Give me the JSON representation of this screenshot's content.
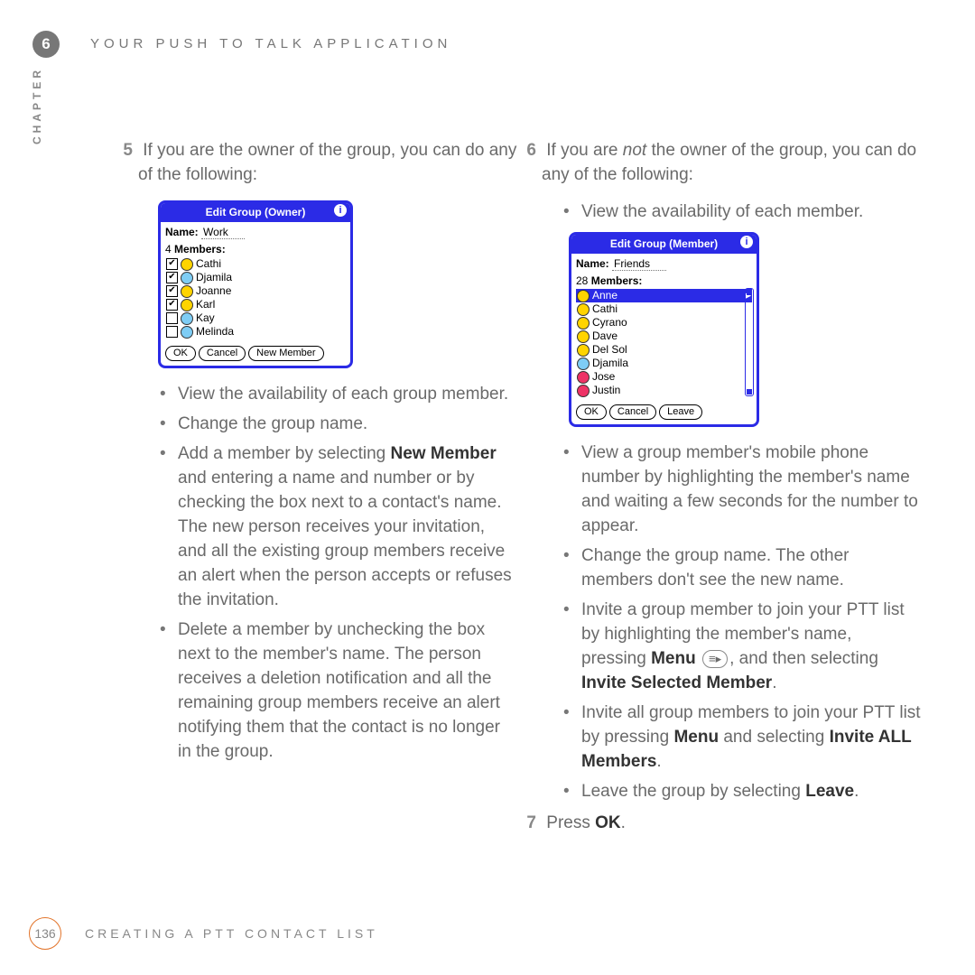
{
  "header": {
    "chapter_number": "6",
    "chapter_title": "YOUR PUSH TO TALK APPLICATION",
    "side_label": "CHAPTER"
  },
  "footer": {
    "page_number": "136",
    "section_title": "CREATING A PTT CONTACT LIST"
  },
  "left": {
    "step_num": "5",
    "intro": "If you are the owner of the group, you can do any of the following:",
    "bullets": {
      "b1": "View the availability of each group member.",
      "b2": "Change the group name.",
      "b3_pre": "Add a member by selecting ",
      "b3_bold": "New Member",
      "b3_post": " and entering a name and number or by checking the box next to a contact's name. The new person receives your invitation, and all the existing group members receive an alert when the person accepts or refuses the invitation.",
      "b4": "Delete a member by unchecking the box next to the member's name. The person receives a deletion notification and all the remaining group members receive an alert notifying them that the contact is no longer in the group."
    }
  },
  "right": {
    "step_num": "6",
    "intro_pre": "If you are ",
    "intro_em": "not",
    "intro_post": " the owner of the group, you can do any of the following:",
    "bullets": {
      "b1": "View the availability of each member.",
      "b2": "View a group member's mobile phone number by highlighting the member's name and waiting a few seconds for the number to appear.",
      "b3": "Change the group name. The other members don't see the new name.",
      "b4_pre": "Invite a group member to join your PTT list by highlighting the member's name, pressing ",
      "b4_menu": "Menu",
      "b4_mid": ", and then selecting ",
      "b4_bold": "Invite Selected Member",
      "b4_end": ".",
      "b5_pre": "Invite all group members to join your PTT list by pressing ",
      "b5_menu": "Menu",
      "b5_mid": " and selecting ",
      "b5_bold": "Invite ALL Members",
      "b5_end": ".",
      "b6_pre": "Leave the group by selecting ",
      "b6_bold": "Leave",
      "b6_end": "."
    },
    "step7_num": "7",
    "step7_pre": "Press ",
    "step7_bold": "OK",
    "step7_end": "."
  },
  "palm_owner": {
    "title": "Edit Group (Owner)",
    "name_lbl": "Name:",
    "name_val": "Work",
    "members_count": "4",
    "members_lbl": "Members:",
    "rows": {
      "r1": "Cathi",
      "r2": "Djamila",
      "r3": "Joanne",
      "r4": "Karl",
      "r5": "Kay",
      "r6": "Melinda"
    },
    "btn_ok": "OK",
    "btn_cancel": "Cancel",
    "btn_new": "New Member"
  },
  "palm_member": {
    "title": "Edit Group (Member)",
    "name_lbl": "Name:",
    "name_val": "Friends",
    "members_count": "28",
    "members_lbl": "Members:",
    "rows": {
      "r1": "Anne",
      "r2": "Cathi",
      "r3": "Cyrano",
      "r4": "Dave",
      "r5": "Del Sol",
      "r6": "Djamila",
      "r7": "Jose",
      "r8": "Justin"
    },
    "btn_ok": "OK",
    "btn_cancel": "Cancel",
    "btn_leave": "Leave"
  },
  "glyphs": {
    "menu_key": "≡▸"
  }
}
